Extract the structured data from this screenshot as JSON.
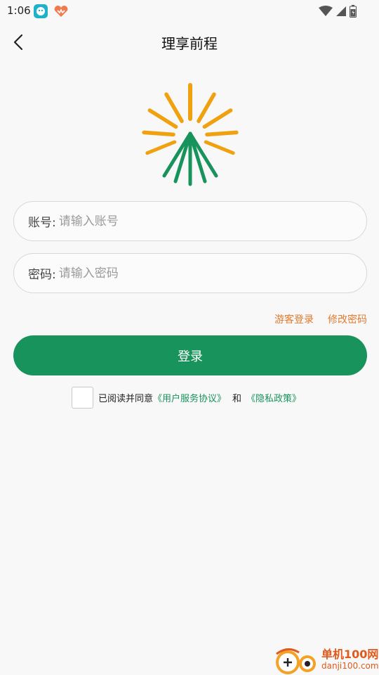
{
  "status_bar": {
    "time": "1:06"
  },
  "header": {
    "title": "理享前程"
  },
  "account_field": {
    "label": "账号:",
    "placeholder": "请输入账号",
    "value": ""
  },
  "password_field": {
    "label": "密码:",
    "placeholder": "请输入密码",
    "value": ""
  },
  "links": {
    "guest_login": "游客登录",
    "change_password": "修改密码"
  },
  "login_button": {
    "label": "登录"
  },
  "agreement": {
    "checked": false,
    "prefix": "已阅读并同意",
    "user_agreement": "《用户服务协议》",
    "and": "和",
    "privacy_policy": "《隐私政策》"
  },
  "watermark": {
    "name": "单机100网",
    "url": "danji100.com"
  },
  "colors": {
    "brand_green": "#17935b",
    "link_orange": "#e07a2e",
    "logo_orange": "#f0a10f",
    "background": "#f8f8f8"
  },
  "icons": [
    "back-arrow-icon",
    "wifi-icon",
    "signal-icon",
    "battery-icon",
    "app-notification-icon",
    "heart-app-icon",
    "sunburst-logo"
  ]
}
